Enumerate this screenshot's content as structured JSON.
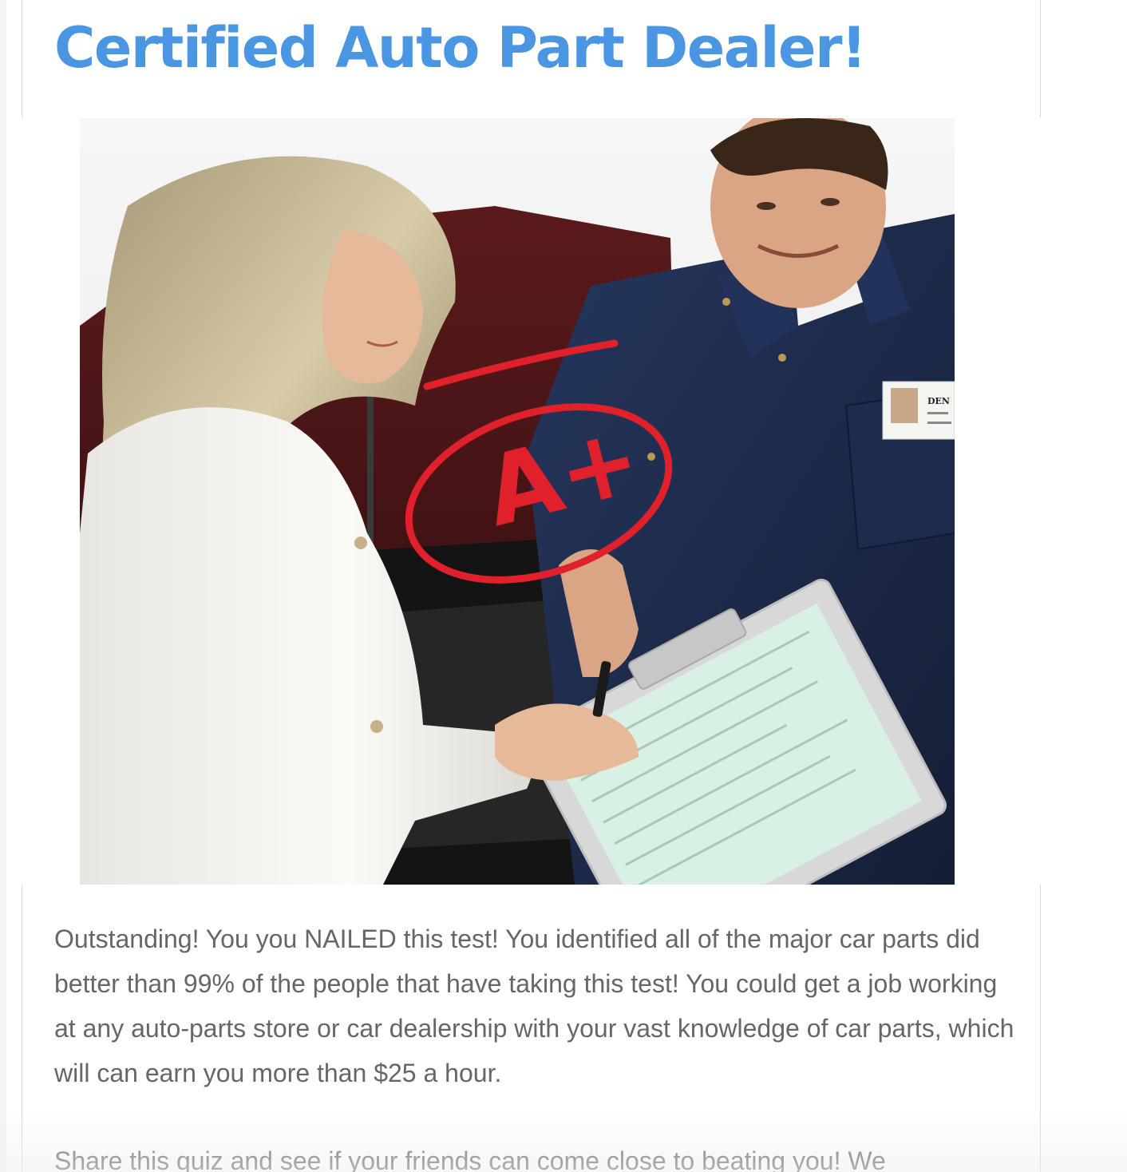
{
  "result": {
    "title": "Certified Auto Part Dealer!",
    "image_alt": "Woman signing a clipboard held by a mechanic, with a red A+ grade circled",
    "grade_mark": "A+",
    "badge_text": "DEN",
    "description": "Outstanding! You you NAILED this test! You identified all of the major car parts did better than 99% of the people that have taking this test! You could get a job working at any auto-parts store or car dealership with your vast knowledge of car parts, which will can earn you more than $25 a hour.",
    "share_text": "Share this quiz and see if your friends can come close to beating you! We"
  },
  "colors": {
    "title": "#4a96e3",
    "body_text": "#666666",
    "grade_red": "#e0202a",
    "uniform_navy": "#1c2a4a"
  }
}
